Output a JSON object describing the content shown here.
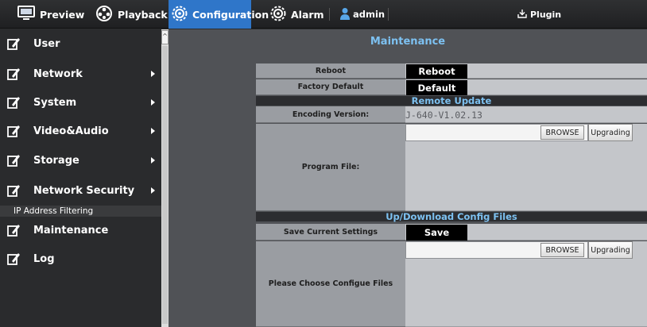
{
  "nav": {
    "preview": "Preview",
    "playback": "Playback",
    "configuration": "Configuration",
    "alarm": "Alarm",
    "user": "admin",
    "plugin": "Plugin"
  },
  "sidebar": {
    "items": [
      {
        "label": "User",
        "arrow": false
      },
      {
        "label": "Network",
        "arrow": true
      },
      {
        "label": "System",
        "arrow": true
      },
      {
        "label": "Video&Audio",
        "arrow": true
      },
      {
        "label": "Storage",
        "arrow": true
      },
      {
        "label": "Network Security",
        "arrow": true
      },
      {
        "label": "Maintenance",
        "arrow": false
      },
      {
        "label": "Log",
        "arrow": false
      }
    ],
    "subitem": "IP Address Filtering"
  },
  "main": {
    "title": "Maintenance",
    "reboot_label": "Reboot",
    "reboot_button": "Reboot",
    "factory_label": "Factory Default",
    "default_button": "Default",
    "remote_update_header": "Remote Update",
    "encoding_label": "Encoding Version:",
    "encoding_value": "J-640-V1.02.13",
    "program_file_label": "Program File:",
    "browse_label": "BROWSE",
    "upgrading_label": "Upgrading",
    "config_header": "Up/Download Config Files",
    "save_settings_label": "Save Current Settings",
    "save_button": "Save",
    "config_files_label": "Please Choose Configue Files",
    "browse_label2": "BROWSE",
    "upgrading_label2": "Upgrading"
  },
  "colors": {
    "accent": "#2f76c9",
    "title": "#7dc1f1"
  }
}
